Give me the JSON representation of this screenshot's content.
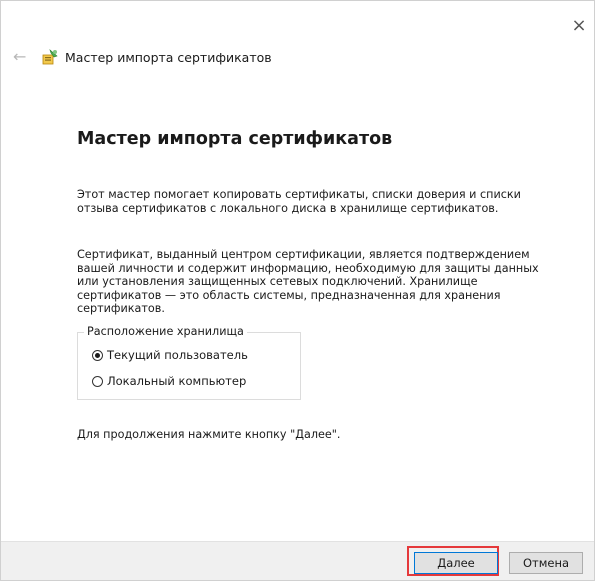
{
  "window": {
    "close_glyph": "×",
    "back_icon": "back-arrow-icon",
    "wizard_icon": "certificate-wizard-icon",
    "header_title": "Мастер импорта сертификатов"
  },
  "main": {
    "title": "Мастер импорта сертификатов",
    "paragraph1": "Этот мастер помогает копировать сертификаты, списки доверия и списки отзыва сертификатов с локального диска в хранилище сертификатов.",
    "paragraph2": "Сертификат, выданный центром сертификации, является подтверждением вашей личности и содержит информацию, необходимую для защиты данных или установления защищенных сетевых подключений. Хранилище сертификатов — это область системы, предназначенная для хранения сертификатов.",
    "store_location": {
      "legend": "Расположение хранилища",
      "options": [
        {
          "label": "Текущий пользователь",
          "checked": true
        },
        {
          "label": "Локальный компьютер",
          "checked": false
        }
      ]
    },
    "paragraph3": "Для продолжения нажмите кнопку \"Далее\"."
  },
  "footer": {
    "next_label": "Далее",
    "cancel_label": "Отмена",
    "highlight_color": "#e5393b"
  }
}
